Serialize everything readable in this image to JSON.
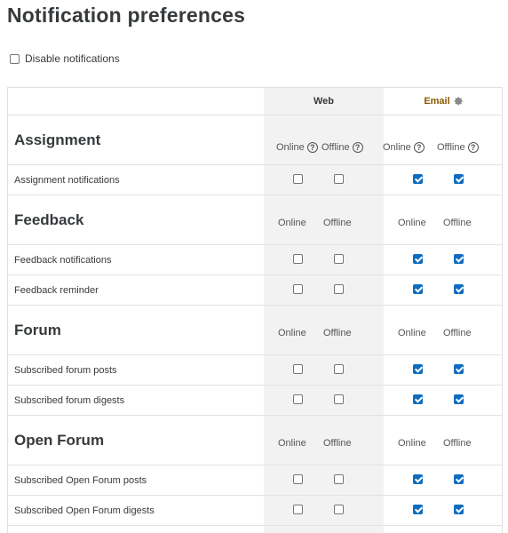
{
  "page": {
    "title": "Notification preferences"
  },
  "disable": {
    "label": "Disable notifications",
    "checked": false
  },
  "columns": {
    "web": "Web",
    "email": "Email",
    "online": "Online",
    "offline": "Offline",
    "email_settings_icon": "gear-icon",
    "help_icon": "question-circle-icon",
    "checked_color": "#0f6cbf"
  },
  "sections": [
    {
      "title": "Assignment",
      "items": [
        {
          "label": "Assignment notifications",
          "web_online": false,
          "web_offline": false,
          "email_online": true,
          "email_offline": true
        }
      ]
    },
    {
      "title": "Feedback",
      "items": [
        {
          "label": "Feedback notifications",
          "web_online": false,
          "web_offline": false,
          "email_online": true,
          "email_offline": true
        },
        {
          "label": "Feedback reminder",
          "web_online": false,
          "web_offline": false,
          "email_online": true,
          "email_offline": true
        }
      ]
    },
    {
      "title": "Forum",
      "items": [
        {
          "label": "Subscribed forum posts",
          "web_online": false,
          "web_offline": false,
          "email_online": true,
          "email_offline": true
        },
        {
          "label": "Subscribed forum digests",
          "web_online": false,
          "web_offline": false,
          "email_online": true,
          "email_offline": true
        }
      ]
    },
    {
      "title": "Open Forum",
      "items": [
        {
          "label": "Subscribed Open Forum posts",
          "web_online": false,
          "web_offline": false,
          "email_online": true,
          "email_offline": true
        },
        {
          "label": "Subscribed Open Forum digests",
          "web_online": false,
          "web_offline": false,
          "email_online": true,
          "email_offline": true
        }
      ]
    }
  ]
}
